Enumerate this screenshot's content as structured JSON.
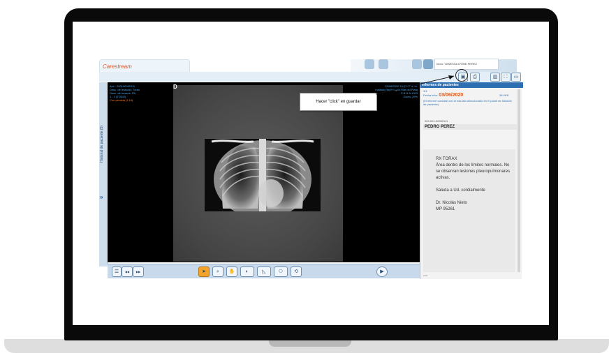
{
  "app": {
    "brand": "Carestream",
    "user_label": "Inicio: VANESSA IVONE PEREZ"
  },
  "left_panel": {
    "title": "Historial de paciente (5)",
    "expand_glyph": "»"
  },
  "viewer": {
    "orientation_marker": "D",
    "meta_left": {
      "acc": "Acc.: 200100052111",
      "study": "Desc. del estudio: Tórax",
      "series": "Desc. de la serie: PA",
      "range": "1 - 1 (TODO)",
      "compression": "Con pérdida (1:16)"
    },
    "meta_right": {
      "datetime": "03/06/2020 10:03:07 a. m.",
      "institution": "Instituto Radiológico Mar del Plata",
      "window": "C:511 A:1023",
      "zoom": "Zoom: 29%"
    }
  },
  "callout": {
    "text": "Hacer \"click\" en guardar"
  },
  "report": {
    "header": "Informes de pacientes",
    "count": "1/1",
    "date_label": "Fecha infor:",
    "date_value": "03/06/2020",
    "size": "38.4KB",
    "note": "(El informe coincide con el estudio seleccionado en el panel de historial de paciente)",
    "patient_id": "002-001-00052111",
    "patient_name": "PEDRO PEREZ",
    "body_lines": [
      "RX TORAX",
      "Área dentro de los límites normales. No se observan lesiones pleuropulmonares activas.",
      "",
      "Saluda a Ud. cordialmente",
      "",
      "Dr. Nicolás Nieto",
      "MP 95261"
    ],
    "footer": "Listo"
  },
  "toolbar": {
    "icons": [
      "select-arrow-icon",
      "zoom-icon",
      "pan-hand-icon",
      "window-level-icon",
      "measure-icon",
      "user-icon",
      "rotate-icon"
    ],
    "glyphs": [
      "➤",
      "⌕",
      "✋",
      "◐",
      "◺",
      "⚇",
      "⟲"
    ],
    "play_glyph": "▶",
    "nav_left_glyph": "◀◀",
    "nav_right_glyph": "▶▶"
  },
  "colors": {
    "accent_blue": "#2e6fb1",
    "overlay_text": "#4fa8ef",
    "date_highlight": "#e05a1c",
    "active_tool": "#f4a32a"
  }
}
